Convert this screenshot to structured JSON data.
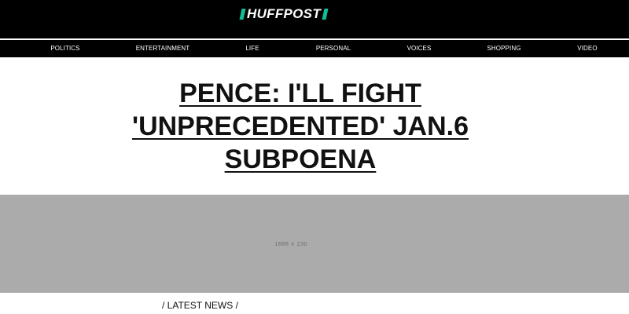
{
  "header": {
    "logo_text": "HUFFPOST",
    "accent_color": "#0dbe98"
  },
  "nav": {
    "items": [
      {
        "label": "POLITICS"
      },
      {
        "label": "ENTERTAINMENT"
      },
      {
        "label": "LIFE"
      },
      {
        "label": "PERSONAL"
      },
      {
        "label": "VOICES"
      },
      {
        "label": "SHOPPING"
      },
      {
        "label": "VIDEO"
      }
    ]
  },
  "article": {
    "headline": "PENCE: I'LL FIGHT 'UNPRECEDENTED' JAN.6 SUBPOENA"
  },
  "ad": {
    "size_text": "1688 × 230"
  },
  "section": {
    "label": "/ LATEST NEWS /"
  }
}
